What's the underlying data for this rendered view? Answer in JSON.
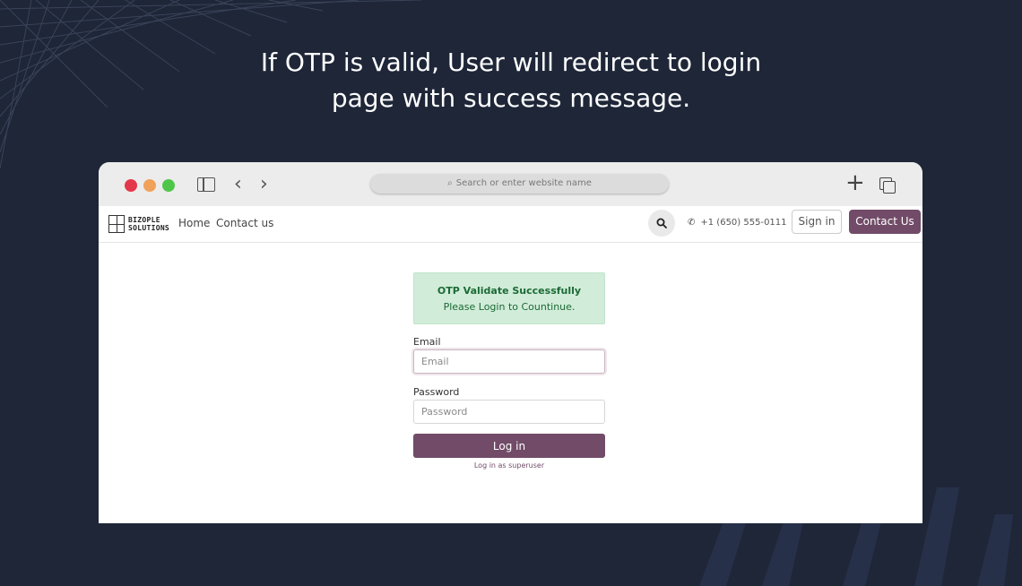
{
  "headline": {
    "line1": "If OTP is valid, User will redirect to login",
    "line2": "page with success message."
  },
  "browser": {
    "address_placeholder": "Search or enter website name",
    "icons": [
      "close-dot",
      "minimize-dot",
      "maximize-dot",
      "sidebar-icon",
      "back-icon",
      "forward-icon",
      "search-icon",
      "new-tab-icon",
      "tabs-icon"
    ]
  },
  "site": {
    "logo_line1": "BIZOPLE",
    "logo_line2": "SOLUTIONS",
    "nav": {
      "home": "Home",
      "contact": "Contact us"
    },
    "phone": "+1 (650) 555-0111",
    "signin": "Sign in",
    "contact_button": "Contact Us"
  },
  "form": {
    "alert_title": "OTP Validate Successfully",
    "alert_message": "Please Login to Countinue.",
    "email_label": "Email",
    "email_placeholder": "Email",
    "password_label": "Password",
    "password_placeholder": "Password",
    "login_button": "Log in",
    "superuser_link": "Log in as superuser"
  },
  "colors": {
    "background": "#1e2638",
    "brand": "#714b67",
    "alert_bg": "#d1ecd9",
    "alert_text": "#1b6b35"
  }
}
